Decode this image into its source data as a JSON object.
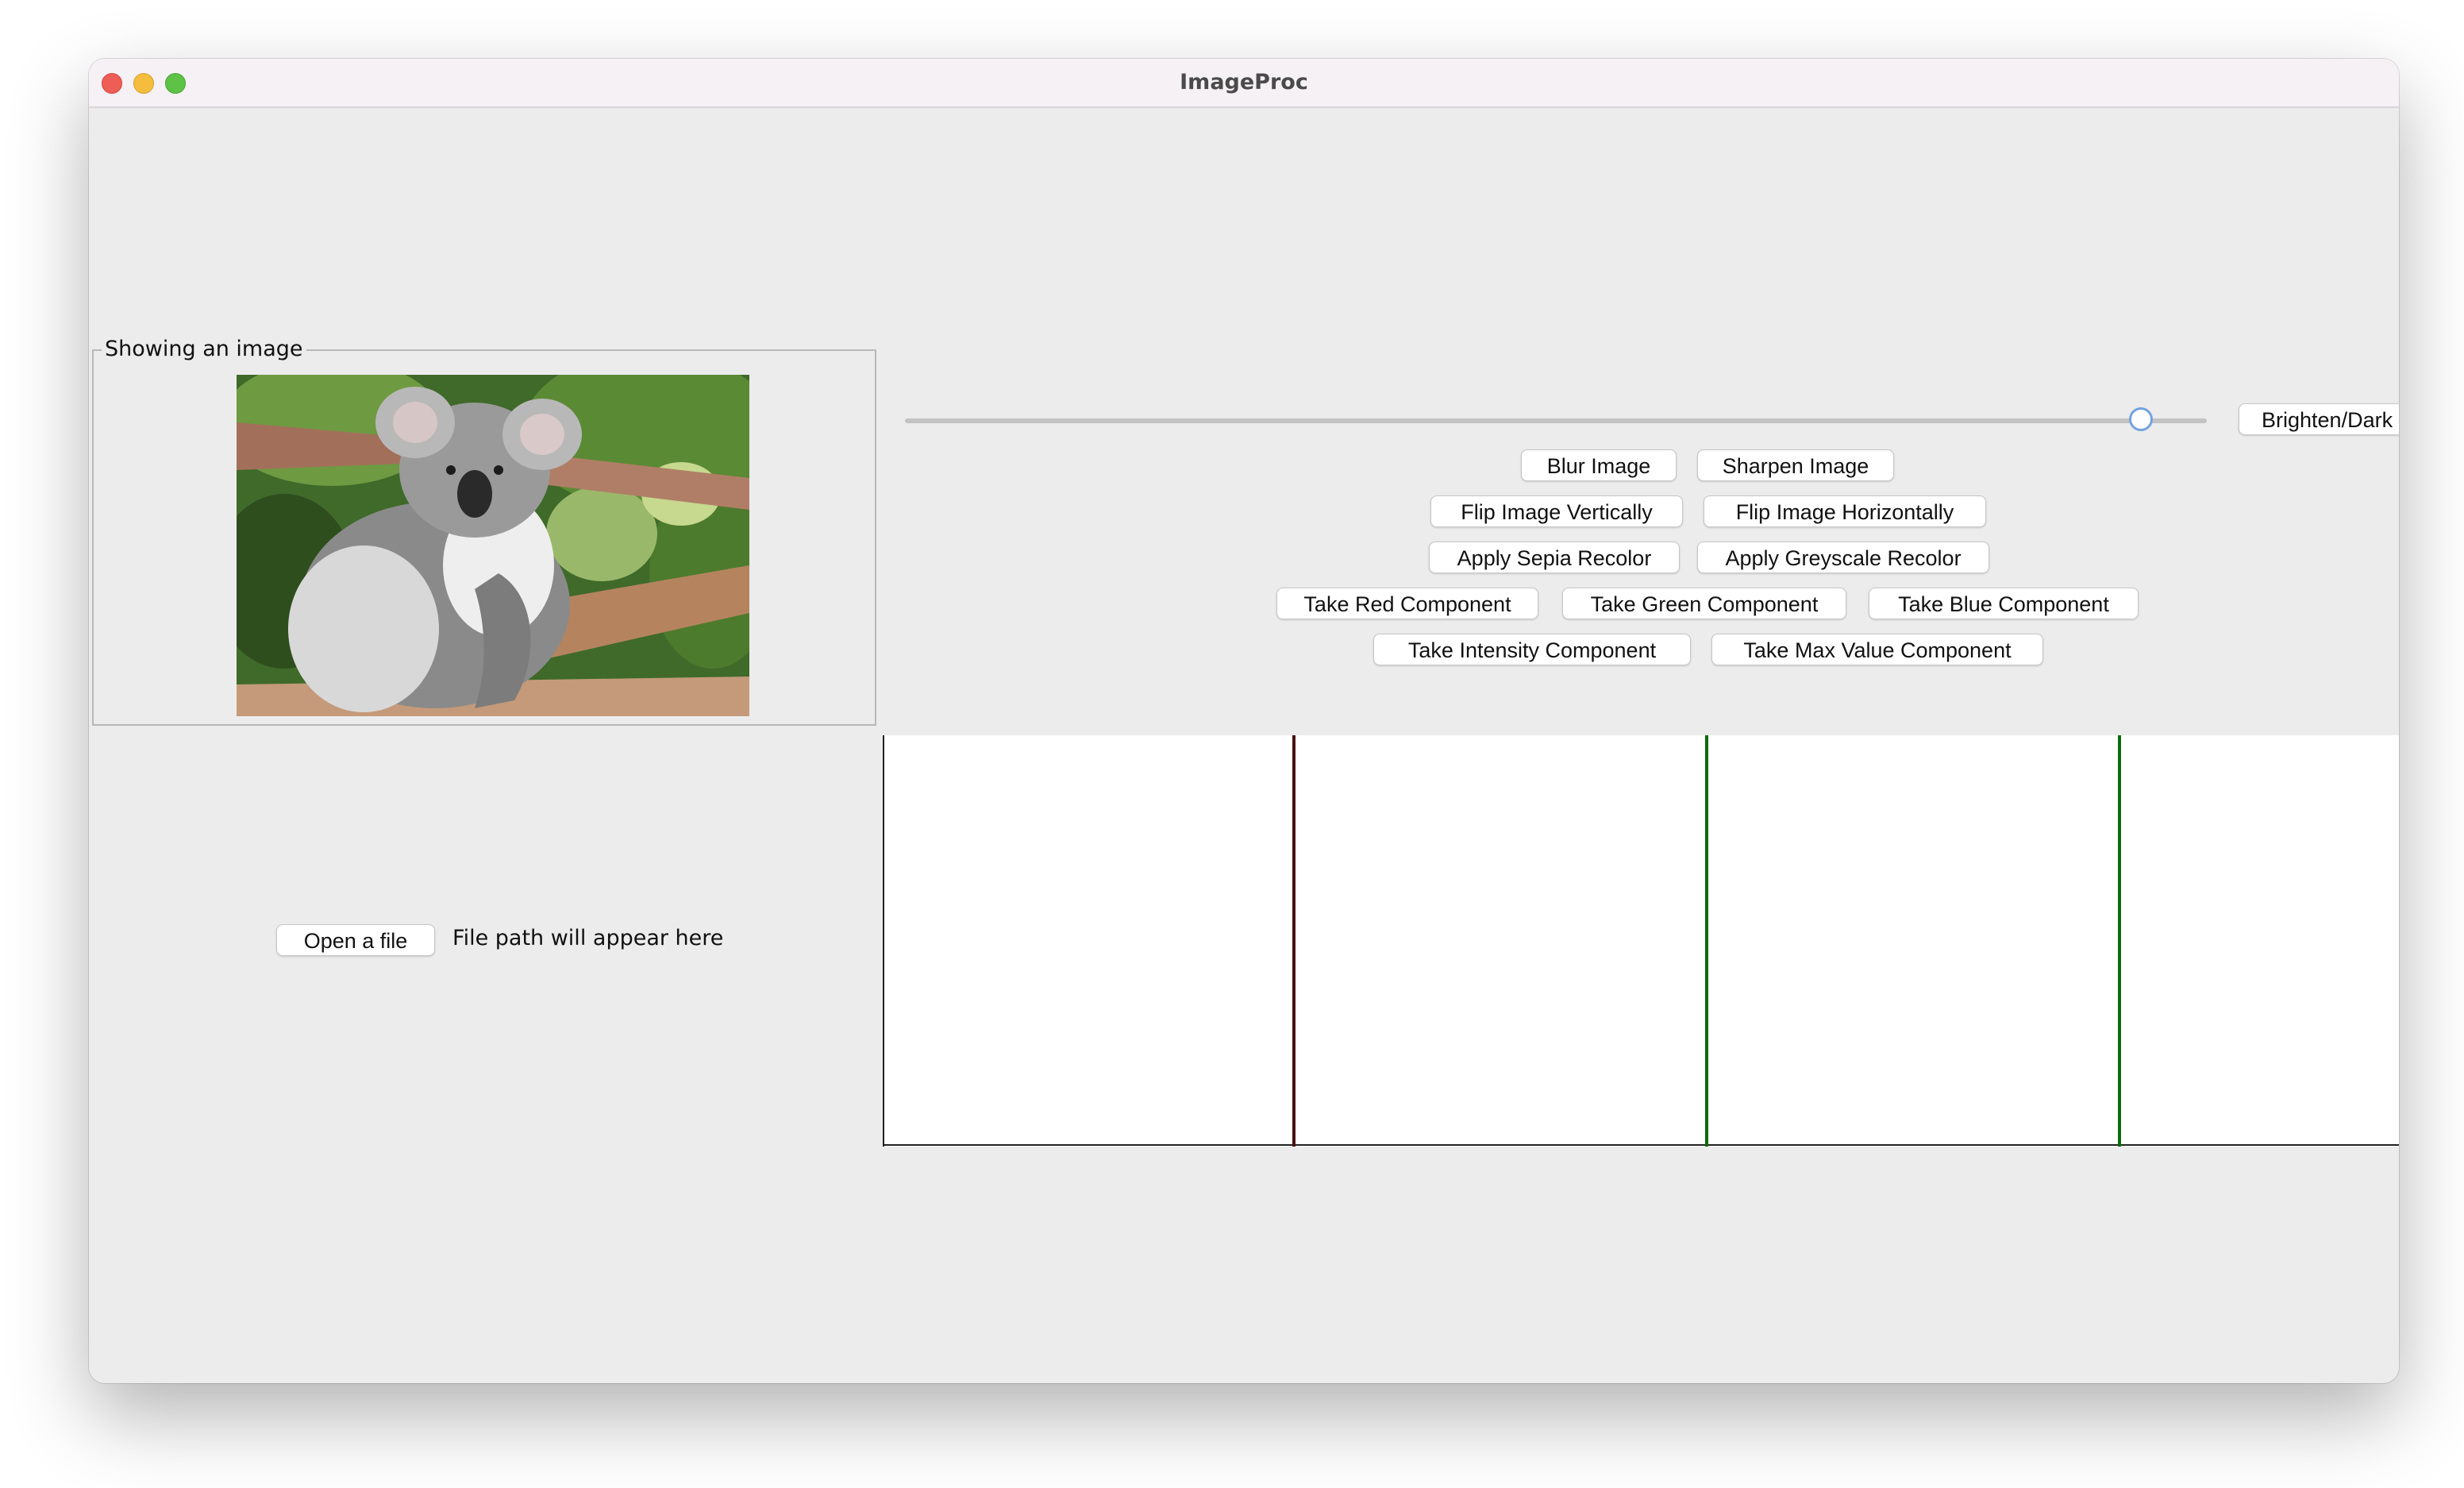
{
  "window": {
    "title": "ImageProc"
  },
  "image_panel": {
    "label": "Showing an image",
    "image_alt": "koala"
  },
  "slider": {
    "value_fraction": 0.95
  },
  "buttons": {
    "brighten": "Brighten/Dark",
    "blur": "Blur Image",
    "sharpen": "Sharpen Image",
    "flip_vertical": "Flip Image Vertically",
    "flip_horizontal": "Flip Image Horizontally",
    "sepia": "Apply Sepia Recolor",
    "greyscale": "Apply Greyscale Recolor",
    "red": "Take Red Component",
    "green": "Take Green Component",
    "blue": "Take Blue Component",
    "intensity": "Take Intensity Component",
    "max_value": "Take Max Value Component",
    "open_file": "Open a file"
  },
  "file_path_text": "File path will appear here",
  "histogram": {
    "panel_count": 4,
    "line_colors": [
      "#4a1212",
      "#0b6b0b",
      "#0b6b0b"
    ],
    "axis_color": "#222222"
  }
}
